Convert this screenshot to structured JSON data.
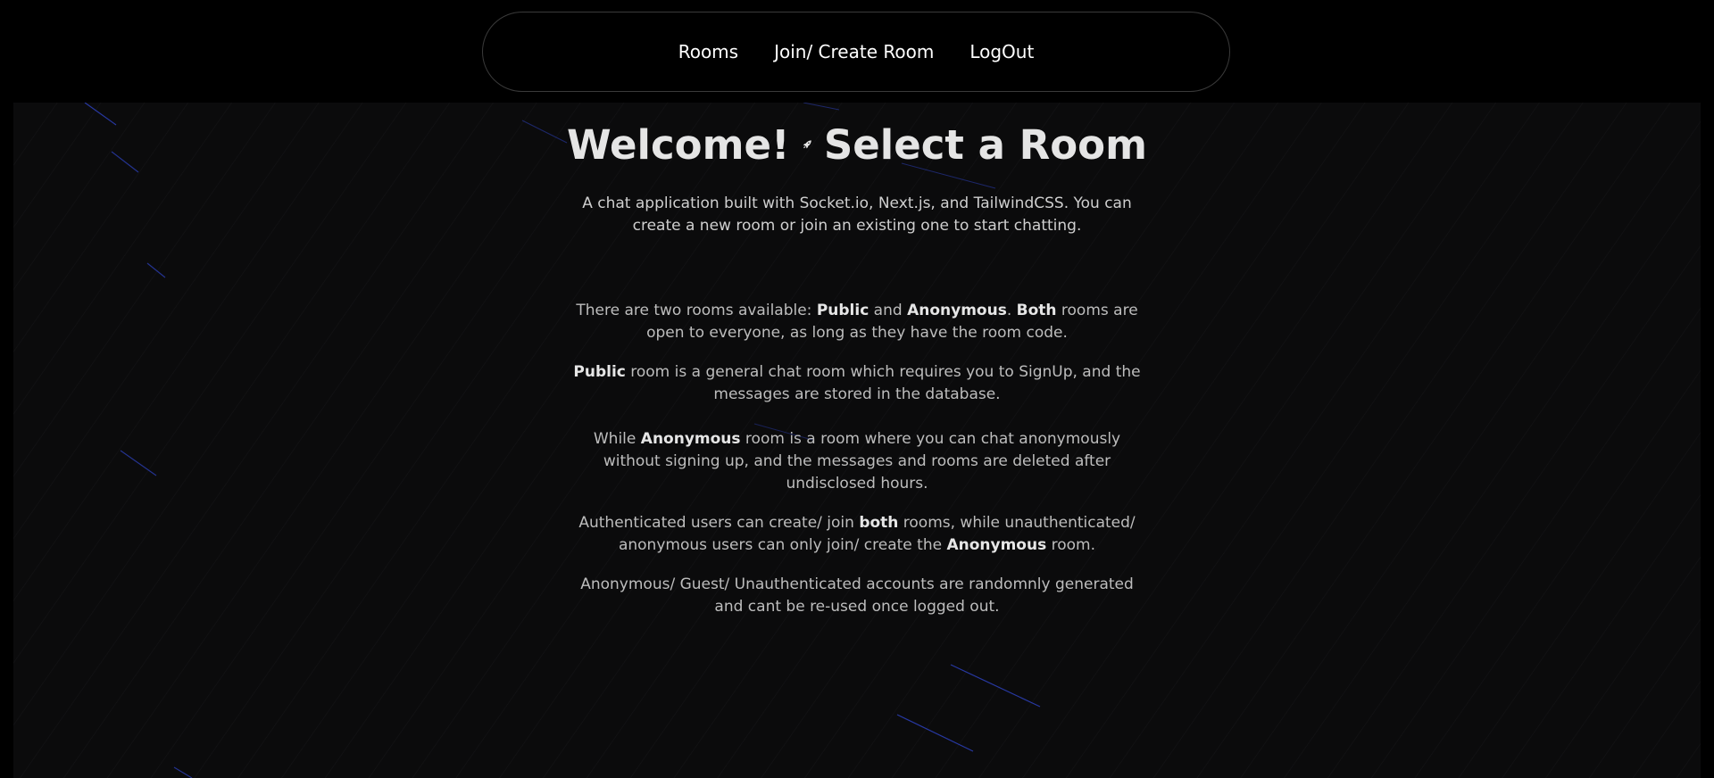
{
  "nav": {
    "items": [
      {
        "label": "Rooms"
      },
      {
        "label": "Join/ Create Room"
      },
      {
        "label": "LogOut"
      }
    ]
  },
  "hero": {
    "title_left": "Welcome!",
    "title_icon": "rocket-icon",
    "title_right": "Select a Room",
    "subtitle": "A chat application built with Socket.io, Next.js, and TailwindCSS. You can create a new room or join an existing one to start chatting."
  },
  "info": {
    "p1": {
      "a": "There are two rooms available: ",
      "b1": "Public",
      "c": " and ",
      "b2": "Anonymous",
      "d": ". ",
      "b3": "Both",
      "e": " rooms are open to everyone, as long as they have the room code."
    },
    "p2": {
      "b1": "Public",
      "a": " room is a general chat room which requires you to SignUp, and the messages are stored in the database."
    },
    "p3": {
      "a": "While ",
      "b1": "Anonymous",
      "c": " room is a room where you can chat anonymously without signing up, and the messages and rooms are deleted after undisclosed hours."
    },
    "p4": {
      "a": "Authenticated users can create/ join ",
      "b1": "both",
      "c": " rooms, while unauthenticated/ anonymous users can only join/ create the ",
      "b2": "Anonymous",
      "d": " room."
    },
    "p5": {
      "a": "Anonymous/ Guest/ Unauthenticated accounts are randomnly generated and cant be re-used once logged out."
    }
  },
  "colors": {
    "background": "#000000",
    "panel": "#0b0b0c",
    "meteor": "#3b4fd6",
    "text": "#bdbdbd"
  }
}
